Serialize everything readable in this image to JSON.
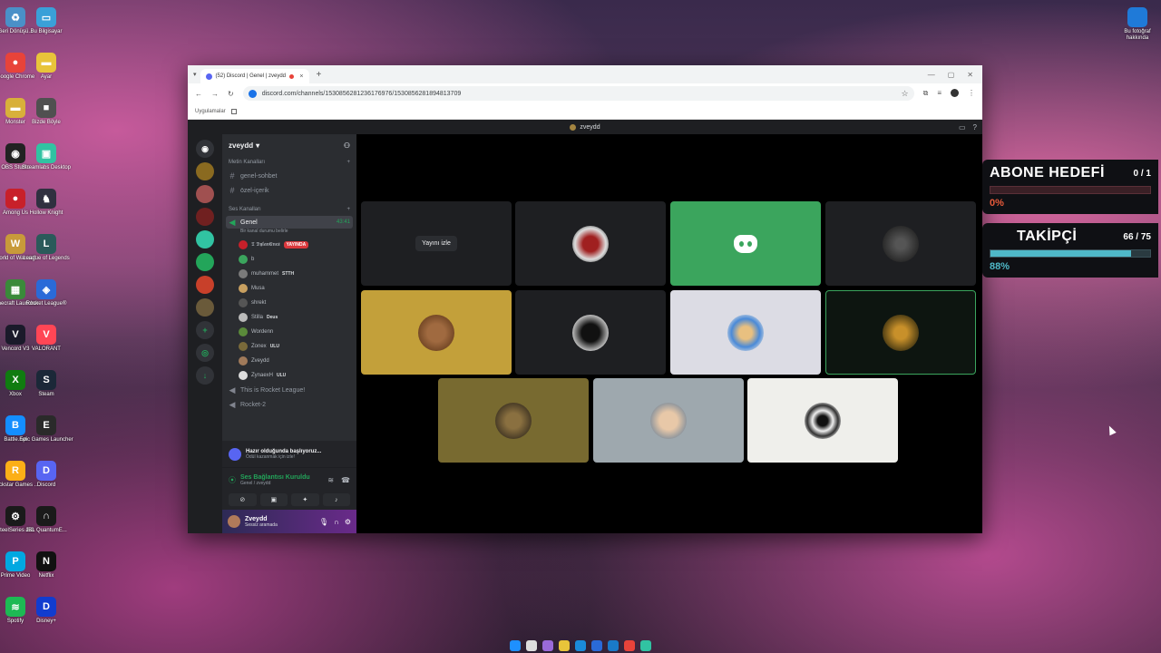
{
  "desktop": {
    "icons": [
      {
        "label": "Geri Dönüşü...",
        "color": "#4a90c8",
        "icon": "recycle-bin-icon",
        "glyph": "♻"
      },
      {
        "label": "Bu Bilgisayar",
        "color": "#3aa0d8",
        "icon": "computer-icon",
        "glyph": "▭"
      },
      {
        "label": "Google Chrome",
        "color": "#e8433a",
        "icon": "chrome-icon",
        "glyph": "●"
      },
      {
        "label": "Ayar",
        "color": "#e8c43a",
        "icon": "folder-icon",
        "glyph": "▬"
      },
      {
        "label": "Monster",
        "color": "#d8b03a",
        "icon": "folder-icon",
        "glyph": "▬"
      },
      {
        "label": "Bizde Böyle",
        "color": "#505050",
        "icon": "game-icon",
        "glyph": "■"
      },
      {
        "label": "OBS Studio",
        "color": "#222222",
        "icon": "obs-icon",
        "glyph": "◉"
      },
      {
        "label": "Streamlabs Desktop",
        "color": "#31c3a2",
        "icon": "streamlabs-icon",
        "glyph": "▣"
      },
      {
        "label": "Among Us",
        "color": "#c8202a",
        "icon": "among-us-icon",
        "glyph": "●"
      },
      {
        "label": "Hollow Knight",
        "color": "#303040",
        "icon": "hollow-knight-icon",
        "glyph": "♞"
      },
      {
        "label": "World of Warcraft",
        "color": "#c89a3a",
        "icon": "wow-icon",
        "glyph": "W"
      },
      {
        "label": "League of Legends",
        "color": "#2a5a5a",
        "icon": "lol-icon",
        "glyph": "L"
      },
      {
        "label": "Minecraft Launcher",
        "color": "#3a8a3a",
        "icon": "minecraft-icon",
        "glyph": "▦"
      },
      {
        "label": "Rocket League®",
        "color": "#2a6ad8",
        "icon": "rocket-league-icon",
        "glyph": "◈"
      },
      {
        "label": "Vencord V3",
        "color": "#1a1a2a",
        "icon": "vencord-icon",
        "glyph": "V"
      },
      {
        "label": "VALORANT",
        "color": "#ff4655",
        "icon": "valorant-icon",
        "glyph": "V"
      },
      {
        "label": "Xbox",
        "color": "#107c10",
        "icon": "xbox-icon",
        "glyph": "X"
      },
      {
        "label": "Steam",
        "color": "#1b2838",
        "icon": "steam-icon",
        "glyph": "S"
      },
      {
        "label": "Battle.net",
        "color": "#148eff",
        "icon": "battlenet-icon",
        "glyph": "B"
      },
      {
        "label": "Epic Games Launcher",
        "color": "#2a2a2a",
        "icon": "epic-icon",
        "glyph": "E"
      },
      {
        "label": "Rockstar Games ...",
        "color": "#fcaf17",
        "icon": "rockstar-icon",
        "glyph": "R"
      },
      {
        "label": "Discord",
        "color": "#5865f2",
        "icon": "discord-icon",
        "glyph": "D"
      },
      {
        "label": "SteelSeries GG",
        "color": "#1a1a1a",
        "icon": "steelseries-icon",
        "glyph": "⚙"
      },
      {
        "label": "JBL QuantumE...",
        "color": "#1a1a1a",
        "icon": "jbl-icon",
        "glyph": "∩"
      },
      {
        "label": "Prime Video",
        "color": "#00a8e1",
        "icon": "prime-video-icon",
        "glyph": "P"
      },
      {
        "label": "Netflix",
        "color": "#111111",
        "icon": "netflix-icon",
        "glyph": "N"
      },
      {
        "label": "Spotify",
        "color": "#1db954",
        "icon": "spotify-icon",
        "glyph": "≋"
      },
      {
        "label": "Disney+",
        "color": "#113ccf",
        "icon": "disney-icon",
        "glyph": "D"
      }
    ],
    "right_icon": {
      "label": "Bu fotoğraf hakkında"
    }
  },
  "browser": {
    "tab_title": "(52) Discord | Genel | zveydd",
    "tab_close": "×",
    "new_tab": "+",
    "url": "discord.com/channels/1530856281236176976/1530856281894813709",
    "bookmarks_label": "Uygulamalar"
  },
  "discord": {
    "window_title": "zveydd",
    "server_name": "zveydd",
    "categories": {
      "text": "Metin Kanalları",
      "voice": "Ses Kanalları"
    },
    "text_channels": [
      "genel-sohbet",
      "özel-içerik"
    ],
    "voice_channel": {
      "name": "Genel",
      "time": "43:41",
      "status": "Bir kanal durumu belirle"
    },
    "voice_users": [
      {
        "name": "𝕿 𝕯𝖞𝖑𝖆𝖓𝕰𝖓𝖊𝖝",
        "badge": "YAYINDA",
        "color": "#c8202a"
      },
      {
        "name": "b",
        "badge": "",
        "color": "#3ba55d"
      },
      {
        "name": "muhammet",
        "badge": "STTH",
        "color": "#7a7a7a"
      },
      {
        "name": "Musa",
        "badge": "",
        "color": "#c8a060"
      },
      {
        "name": "shrekt",
        "badge": "",
        "color": "#555555"
      },
      {
        "name": "Stilla",
        "badge": "Deus",
        "color": "#bbbbbb"
      },
      {
        "name": "Wordenn",
        "badge": "",
        "color": "#5a8a3a"
      },
      {
        "name": "Zonex",
        "badge": "ULU",
        "color": "#7a6a3a"
      },
      {
        "name": "Zveydd",
        "badge": "",
        "color": "#a07a5a"
      },
      {
        "name": "ZynaexH",
        "badge": "ULU",
        "color": "#dddddd"
      }
    ],
    "other_voice_channels": [
      "This is Rocket League!",
      "Rocket-2"
    ],
    "activity": {
      "title": "Hazır olduğunda başlıyoruz...",
      "sub": "Ödül kazanmak için izle!"
    },
    "voice_connection": {
      "title": "Ses Bağlantısı Kuruldu",
      "sub": "Genel / zveydd"
    },
    "user": {
      "name": "Zveydd",
      "status": "Sessiz aramada"
    },
    "watch_label": "Yayını izle"
  },
  "overlay": {
    "sub_goal": {
      "title": "ABONE HEDEFİ",
      "count": "0 / 1",
      "percent_label": "0%",
      "fraction": 0,
      "fill_color": "#e8433a",
      "text_color": "#e85a3a"
    },
    "followers": {
      "title": "TAKİPÇİ",
      "count": "66 / 75",
      "percent_label": "88%",
      "fraction": 0.88,
      "fill_color": "#4fb8c8",
      "text_color": "#4fb8c8"
    }
  }
}
